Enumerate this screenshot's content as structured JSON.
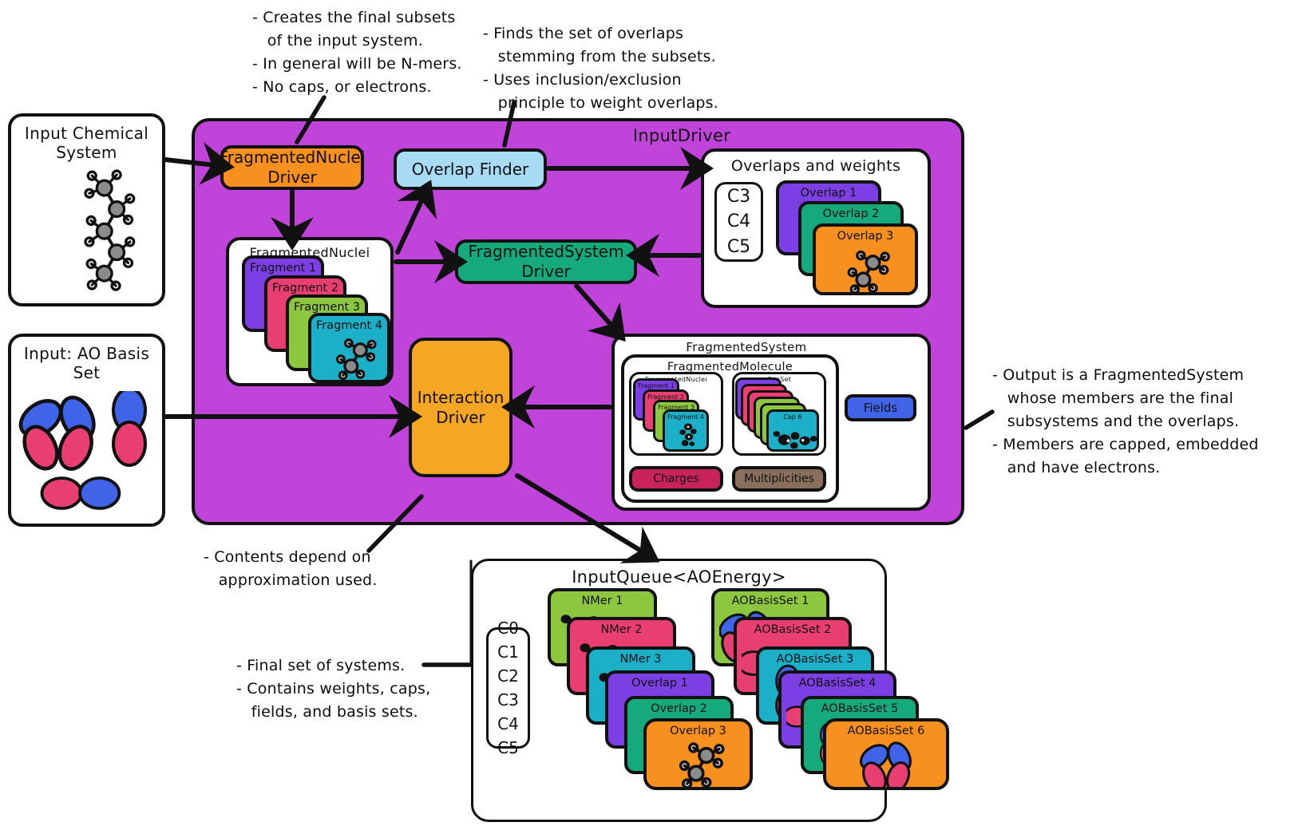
{
  "annotations": {
    "fragmented_nuclei_driver_note": "- Creates the final subsets\n   of the input system.\n- In general will be N-mers.\n- No caps, or electrons.",
    "overlap_finder_note": "- Finds the set of overlaps\n   stemming from the subsets.\n- Uses inclusion/exclusion\n   principle to weight overlaps.",
    "output_note": "- Output is a FragmentedSystem\n   whose members are the final\n   subsystems and the overlaps.\n- Members are capped, embedded\n   and have electrons.",
    "interaction_driver_note": "- Contents depend on\n   approximation used.",
    "input_queue_note": "- Final set of systems.\n- Contains weights, caps,\n   fields, and basis sets."
  },
  "inputs": {
    "chemical_system": {
      "title": "Input Chemical\nSystem"
    },
    "ao_basis_set": {
      "title": "Input: AO Basis\nSet"
    }
  },
  "input_driver": {
    "title": "InputDriver",
    "nodes": {
      "fragmented_nuclei_driver": "FragmentedNuclei\nDriver",
      "overlap_finder": "Overlap Finder",
      "fragmented_system_driver": "FragmentedSystem\nDriver",
      "interaction_driver": "Interaction\nDriver"
    },
    "fragmented_nuclei": {
      "title": "FragmentedNuclei",
      "cards": [
        {
          "label": "Fragment 1",
          "color": "#7B3FE4"
        },
        {
          "label": "Fragment 2",
          "color": "#E83E72"
        },
        {
          "label": "Fragment 3",
          "color": "#8DC63F"
        },
        {
          "label": "Fragment 4",
          "color": "#1BAFC8"
        }
      ]
    },
    "overlaps_and_weights": {
      "title": "Overlaps and weights",
      "weights": [
        "C3",
        "C4",
        "C5"
      ],
      "cards": [
        {
          "label": "Overlap 1",
          "color": "#7B3FE4"
        },
        {
          "label": "Overlap 2",
          "color": "#16A97B"
        },
        {
          "label": "Overlap 3",
          "color": "#F7901E"
        }
      ]
    },
    "fragmented_system": {
      "title": "FragmentedSystem",
      "fragmented_molecule": {
        "title": "FragmentedMolecule",
        "fragmented_nuclei": {
          "title": "FragmentedNuclei",
          "cards": [
            {
              "label": "Fragment 1",
              "color": "#7B3FE4"
            },
            {
              "label": "Fragment 2",
              "color": "#E83E72"
            },
            {
              "label": "Fragment 3",
              "color": "#8DC63F"
            },
            {
              "label": "Fragment 4",
              "color": "#1BAFC8"
            }
          ]
        },
        "cap_set": {
          "title": "CapSet",
          "cards": [
            {
              "label": "",
              "color": "#7B3FE4"
            },
            {
              "label": "",
              "color": "#E83E72"
            },
            {
              "label": "",
              "color": "#E83E72"
            },
            {
              "label": "",
              "color": "#8DC63F"
            },
            {
              "label": "",
              "color": "#8DC63F"
            },
            {
              "label": "Cap 6",
              "color": "#1BAFC8"
            }
          ]
        },
        "charges_label": "Charges",
        "multiplicities_label": "Multiplicities"
      },
      "fields_label": "Fields"
    }
  },
  "input_queue": {
    "title": "InputQueue<AOEnergy>",
    "weights": [
      "C0",
      "C1",
      "C2",
      "C3",
      "C4",
      "C5"
    ],
    "systems": [
      {
        "label": "NMer 1",
        "color": "#8DC63F"
      },
      {
        "label": "NMer 2",
        "color": "#E83E72"
      },
      {
        "label": "NMer 3",
        "color": "#1BAFC8"
      },
      {
        "label": "Overlap 1",
        "color": "#7B3FE4"
      },
      {
        "label": "Overlap 2",
        "color": "#16A97B"
      },
      {
        "label": "Overlap 3",
        "color": "#F7901E"
      }
    ],
    "basis_sets": [
      {
        "label": "AOBasisSet 1",
        "color": "#8DC63F"
      },
      {
        "label": "AOBasisSet 2",
        "color": "#E83E72"
      },
      {
        "label": "AOBasisSet 3",
        "color": "#1BAFC8"
      },
      {
        "label": "AOBasisSet 4",
        "color": "#7B3FE4"
      },
      {
        "label": "AOBasisSet 5",
        "color": "#16A97B"
      },
      {
        "label": "AOBasisSet 6",
        "color": "#F7901E"
      }
    ]
  },
  "colors": {
    "input_driver_bg": "#C044DA",
    "orange": "#F7901E",
    "light_blue": "#A8DCF5",
    "teal_green": "#16A97B",
    "amber": "#F5A623",
    "fields_blue": "#4063E8",
    "charges": "#C9235C",
    "multiplicities": "#8B6F5E",
    "outline": "#111111"
  },
  "icons": {
    "molecule": "molecule-icon",
    "orbital": "orbital-icon",
    "arrow": "arrow-icon"
  }
}
